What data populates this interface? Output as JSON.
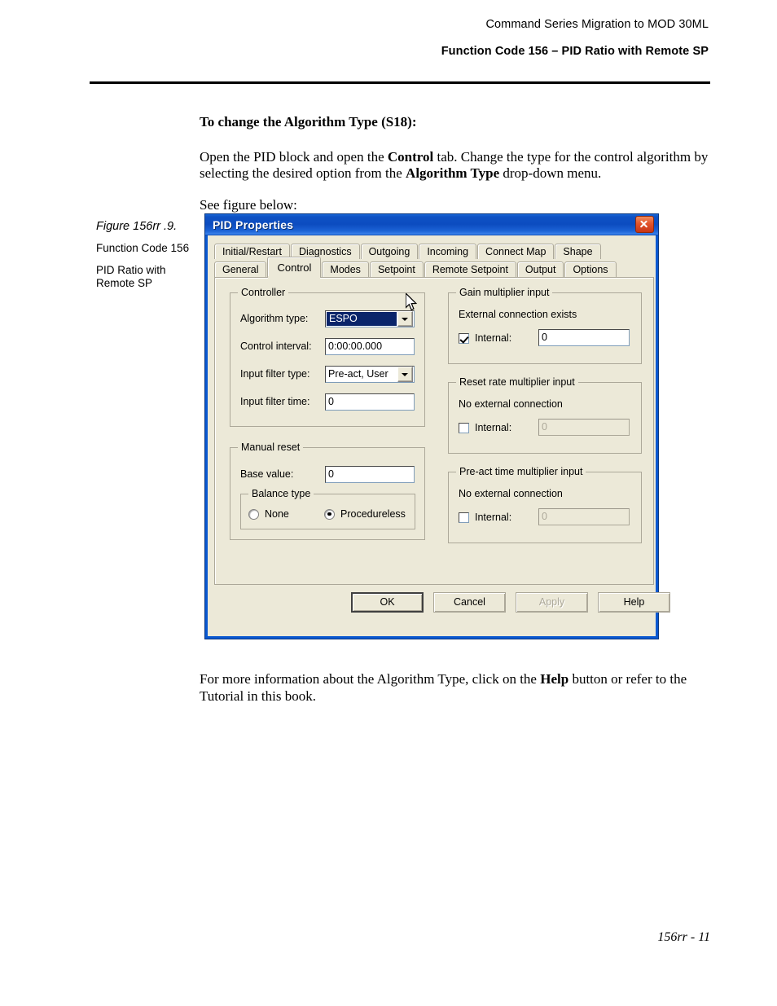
{
  "header": {
    "line1": "Command Series Migration to MOD 30ML",
    "line2": "Function Code 156 – PID Ratio with Remote SP"
  },
  "body": {
    "heading": "To change the Algorithm Type (S18):",
    "para1_a": "Open the PID block and open the ",
    "para1_b": "Control",
    "para1_c": " tab. Change the type for the control algorithm by selecting the desired option from the ",
    "para1_d": "Algorithm Type",
    "para1_e": " drop-down menu.",
    "para2": "See figure below:",
    "after_a": "For more information about the Algorithm Type, click on the ",
    "after_b": "Help",
    "after_c": " button or refer to the Tutorial in this book."
  },
  "figure_caption": {
    "title": "Figure 156rr .9.",
    "line1": "Function Code 156",
    "line2": "PID Ratio with Remote SP"
  },
  "dialog": {
    "title": "PID Properties",
    "close_icon": "close-icon",
    "tabs_row1": [
      {
        "label": "Initial/Restart",
        "active": false
      },
      {
        "label": "Diagnostics",
        "active": false
      },
      {
        "label": "Outgoing",
        "active": false
      },
      {
        "label": "Incoming",
        "active": false
      },
      {
        "label": "Connect Map",
        "active": false
      },
      {
        "label": "Shape",
        "active": false
      }
    ],
    "tabs_row2": [
      {
        "label": "General",
        "active": false
      },
      {
        "label": "Control",
        "active": true
      },
      {
        "label": "Modes",
        "active": false
      },
      {
        "label": "Setpoint",
        "active": false
      },
      {
        "label": "Remote Setpoint",
        "active": false
      },
      {
        "label": "Output",
        "active": false
      },
      {
        "label": "Options",
        "active": false
      }
    ],
    "controller": {
      "legend": "Controller",
      "algorithm_type_label": "Algorithm type:",
      "algorithm_type_value": "ESPO",
      "control_interval_label": "Control interval:",
      "control_interval_value": "0:00:00.000",
      "input_filter_type_label": "Input filter type:",
      "input_filter_type_value": "Pre-act, User",
      "input_filter_time_label": "Input filter time:",
      "input_filter_time_value": "0"
    },
    "manual_reset": {
      "legend": "Manual reset",
      "base_value_label": "Base value:",
      "base_value": "0",
      "balance_type_legend": "Balance type",
      "option_none": "None",
      "option_procedureless": "Procedureless",
      "selected": "Procedureless"
    },
    "gain_multiplier": {
      "legend": "Gain multiplier input",
      "status": "External connection exists",
      "internal_label": "Internal:",
      "internal_checked": true,
      "internal_value": "0"
    },
    "reset_rate_multiplier": {
      "legend": "Reset rate multiplier input",
      "status": "No external connection",
      "internal_label": "Internal:",
      "internal_checked": false,
      "internal_value": "0"
    },
    "preact_time_multiplier": {
      "legend": "Pre-act time multiplier input",
      "status": "No external connection",
      "internal_label": "Internal:",
      "internal_checked": false,
      "internal_value": "0"
    },
    "buttons": {
      "ok": "OK",
      "cancel": "Cancel",
      "apply": "Apply",
      "help": "Help"
    }
  },
  "footer": {
    "page_number": "156rr - 11"
  }
}
